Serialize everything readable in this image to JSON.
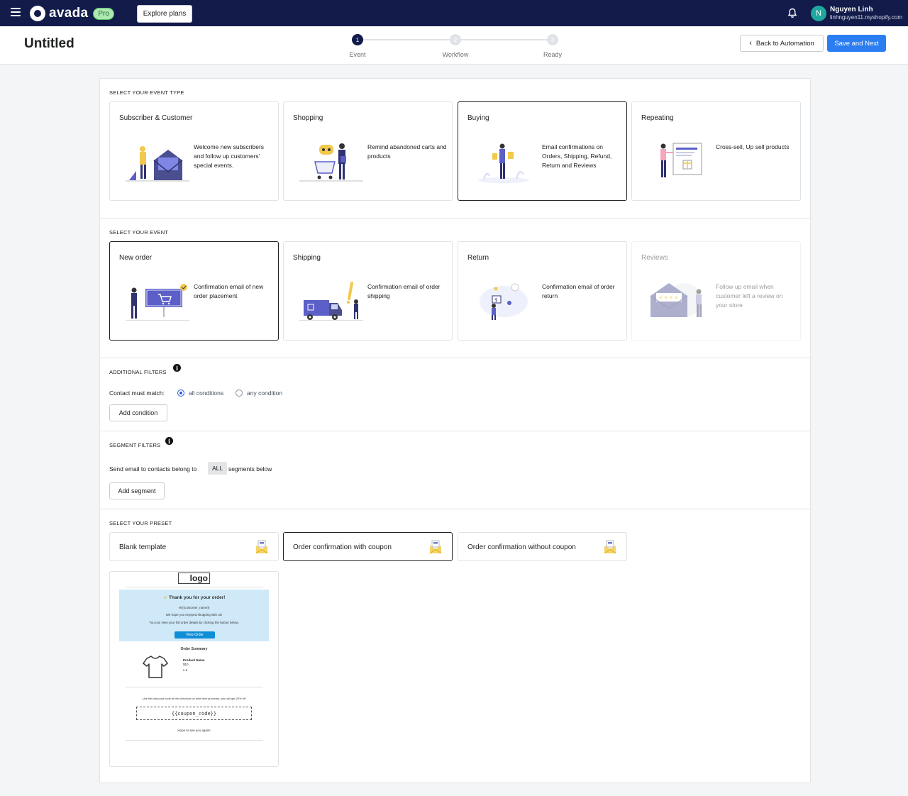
{
  "topbar": {
    "brand": "avada",
    "pro_badge": "Pro",
    "explore_label": "Explore plans",
    "user": {
      "initial": "N",
      "name": "Nguyen Linh",
      "shop": "linhnguyen11.myshopify.com"
    }
  },
  "header": {
    "title": "Untitled",
    "steps": [
      {
        "number": "1",
        "label": "Event",
        "active": true
      },
      {
        "number": "2",
        "label": "Workflow",
        "active": false
      },
      {
        "number": "3",
        "label": "Ready",
        "active": false
      }
    ],
    "back_label": "Back to Automation",
    "save_label": "Save and Next"
  },
  "event_type": {
    "title": "SELECT YOUR EVENT TYPE",
    "cards": [
      {
        "title": "Subscriber & Customer",
        "desc": "Welcome new subscribers and follow up customers' special events.",
        "selected": false
      },
      {
        "title": "Shopping",
        "desc": "Remind abandoned carts and products",
        "selected": false
      },
      {
        "title": "Buying",
        "desc": "Email confirmations on Orders, Shipping, Refund, Return and Reviews",
        "selected": true
      },
      {
        "title": "Repeating",
        "desc": "Cross-sell, Up sell products",
        "selected": false
      }
    ]
  },
  "event": {
    "title": "SELECT YOUR EVENT",
    "cards": [
      {
        "title": "New order",
        "desc": "Confirmation email of new order placement",
        "selected": true
      },
      {
        "title": "Shipping",
        "desc": "Confirmation email of order shipping",
        "selected": false
      },
      {
        "title": "Return",
        "desc": "Confirmation email of order return",
        "selected": false
      },
      {
        "title": "Reviews",
        "desc": "Follow up email when customer left a review on your store",
        "disabled": true
      }
    ]
  },
  "additional_filters": {
    "title": "ADDITIONAL FILTERS",
    "match_label": "Contact must match:",
    "option_all": "all conditions",
    "option_any": "any condition",
    "selected": "all",
    "add_label": "Add condition"
  },
  "segment_filters": {
    "title": "SEGMENT FILTERS",
    "prefix": "Send email to contacts belong to",
    "chip": "ALL",
    "suffix": "segments below",
    "add_label": "Add segment"
  },
  "preset": {
    "title": "SELECT YOUR PRESET",
    "options": [
      {
        "label": "Blank template",
        "selected": false
      },
      {
        "label": "Order confirmation with coupon",
        "selected": true
      },
      {
        "label": "Order confirmation without coupon",
        "selected": false
      }
    ],
    "preview": {
      "logo": "logo",
      "heading": "Thank you for your order!",
      "greeting": "Hi {{customer_name}}",
      "line1": "We hope you enjoyed shopping with us!",
      "line2": "You can view your full order details by clicking the button below.",
      "button": "View Order",
      "summary": "Order Summary",
      "product_name": "Product Name",
      "price": "$10",
      "qty": "x 2",
      "discount_note": "Use this discount code at the checkout on next time purchase, you will get 20% off",
      "coupon": "{{coupon_code}}",
      "footer": "Hope to see you again!"
    }
  },
  "colors": {
    "topbar": "#121b4a",
    "primary": "#2b7ef2",
    "accent_illustration": "#5b5fc7"
  }
}
